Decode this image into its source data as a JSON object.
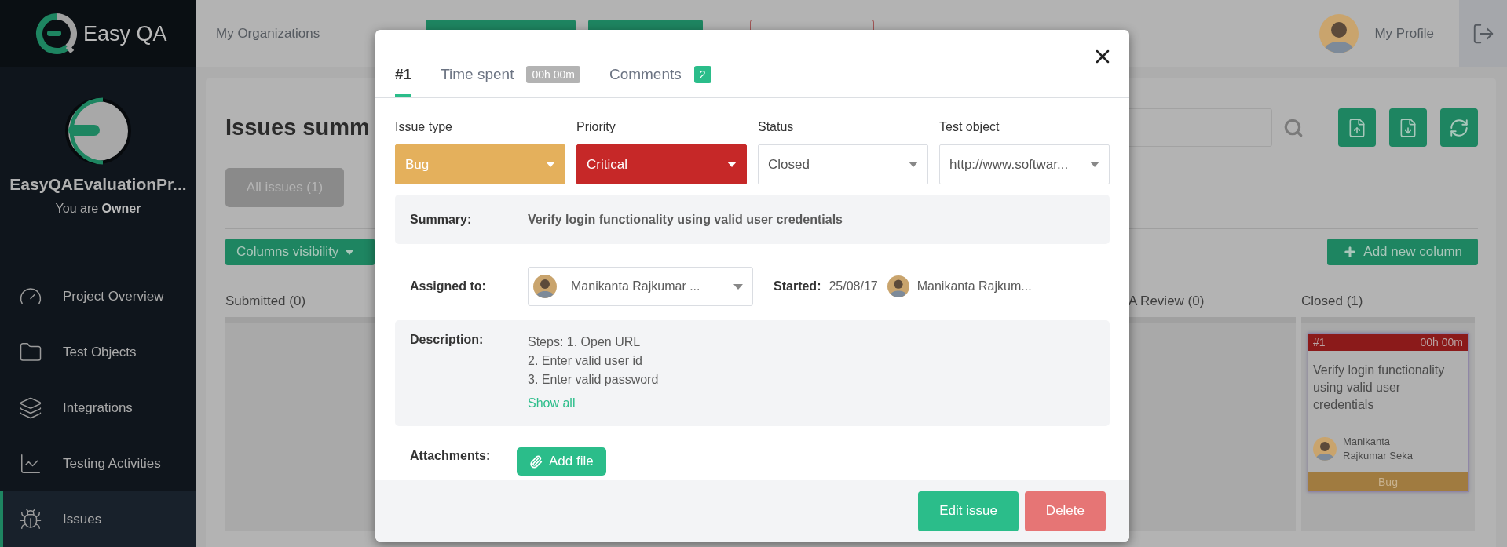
{
  "topbar": {
    "brand": "Easy QA",
    "nav": [
      {
        "label": "My Organizations"
      }
    ],
    "profile": "My Profile"
  },
  "sidebar": {
    "project": "EasyQAEvaluationPr...",
    "role": "You are **Owner**",
    "items": [
      {
        "label": "Project Overview",
        "selected": false
      },
      {
        "label": "Test Objects",
        "selected": false
      },
      {
        "label": "Integrations",
        "selected": false
      },
      {
        "label": "Testing Activities",
        "selected": false
      },
      {
        "label": "Issues",
        "selected": true
      }
    ]
  },
  "page": {
    "title": "Issues summ",
    "filter": {
      "label": "All issues (1)"
    },
    "columns_button": "Columns visibility",
    "add_column_button": "Add new column",
    "columns": [
      {
        "title": "Submitted (0)"
      },
      {
        "title": "A Review (0)"
      },
      {
        "title": "Closed (1)",
        "cards": [
          {
            "number": "#1",
            "time": "00h 00m",
            "summary": "Verify login functionality using valid user credentials",
            "assignee": "Manikanta Rajkumar Seka",
            "type": {
              "label": "Bug",
              "color": "#a07b40"
            },
            "color": "#8b1a1a"
          }
        ]
      }
    ]
  },
  "modal": {
    "tabs": [
      {
        "label": "#1",
        "selected": true
      },
      {
        "label": "Time spent",
        "badge": {
          "text": "00h 00m",
          "color": "#b3b3b3"
        },
        "selected": false
      },
      {
        "label": "Comments",
        "badge": {
          "text": "2",
          "color": "#2bbd8a"
        },
        "selected": false
      }
    ],
    "fields": [
      {
        "label": "Issue type",
        "value": "Bug",
        "color": "#e4b05c"
      },
      {
        "label": "Priority",
        "value": "Critical",
        "color": "#c62828"
      },
      {
        "label": "Status",
        "value": "Closed"
      },
      {
        "label": "Test object",
        "value": "http://www.softwar..."
      }
    ],
    "summary": {
      "label": "Summary:",
      "value": "Verify login functionality using valid user credentials"
    },
    "assigned": {
      "label": "Assigned to:",
      "value": "Manikanta Rajkumar ..."
    },
    "started": {
      "label": "Started:",
      "date": "25/08/17",
      "user": "Manikanta Rajkum..."
    },
    "description": {
      "label": "Description:",
      "lines": [
        "Steps: 1. Open URL",
        "2. Enter valid user id",
        "3. Enter valid password"
      ],
      "link": "Show all"
    },
    "attachments": {
      "label": "Attachments:",
      "button": "Add file"
    },
    "buttons": [
      {
        "label": "Edit issue",
        "kind": "primary"
      },
      {
        "label": "Delete",
        "kind": "danger"
      }
    ]
  }
}
